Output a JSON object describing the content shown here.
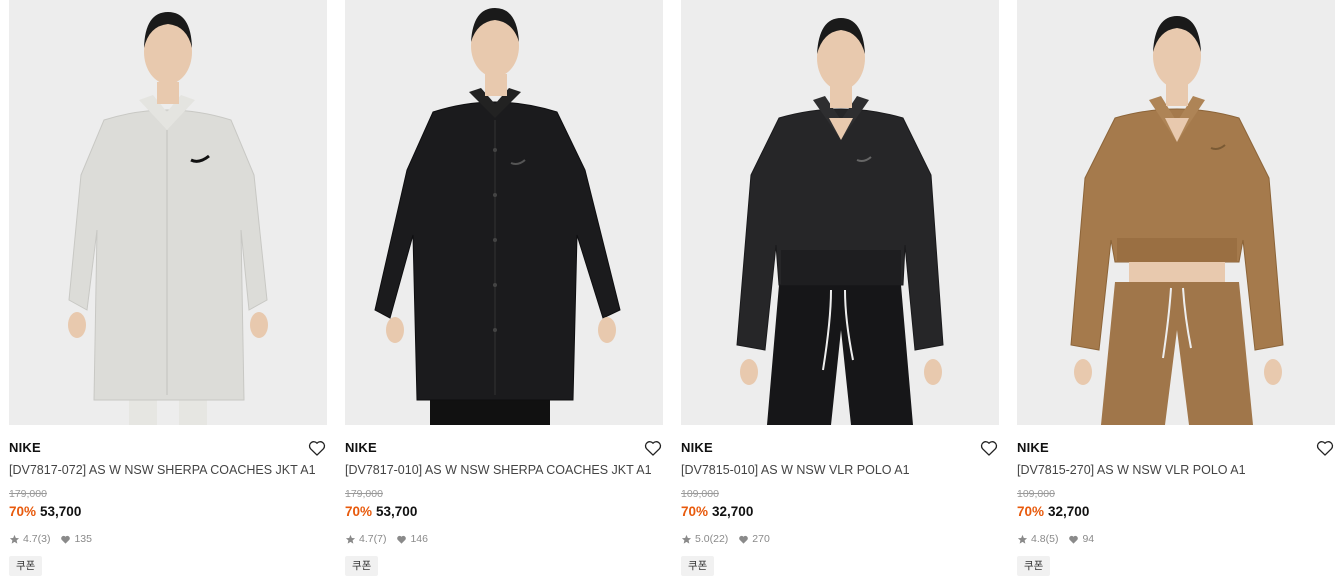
{
  "products": [
    {
      "brand": "NIKE",
      "title": "[DV7817-072] AS W NSW SHERPA COACHES JKT A1",
      "original_price": "179,000",
      "discount": "70%",
      "price": "53,700",
      "rating": "4.7",
      "reviews": "(3)",
      "likes": "135",
      "coupon": "쿠폰",
      "garment_color": "#dcdcd8"
    },
    {
      "brand": "NIKE",
      "title": "[DV7817-010] AS W NSW SHERPA COACHES JKT A1",
      "original_price": "179,000",
      "discount": "70%",
      "price": "53,700",
      "rating": "4.7",
      "reviews": "(7)",
      "likes": "146",
      "coupon": "쿠폰",
      "garment_color": "#1b1b1d"
    },
    {
      "brand": "NIKE",
      "title": "[DV7815-010] AS W NSW VLR POLO A1",
      "original_price": "109,000",
      "discount": "70%",
      "price": "32,700",
      "rating": "5.0",
      "reviews": "(22)",
      "likes": "270",
      "coupon": "쿠폰",
      "garment_color": "#262628"
    },
    {
      "brand": "NIKE",
      "title": "[DV7815-270] AS W NSW VLR POLO A1",
      "original_price": "109,000",
      "discount": "70%",
      "price": "32,700",
      "rating": "4.8",
      "reviews": "(5)",
      "likes": "94",
      "coupon": "쿠폰",
      "garment_color": "#a57a4c"
    }
  ],
  "colors": {
    "discount": "#e85a0c",
    "photo_bg": "#ededed",
    "skin": "#e8c9ae",
    "hair": "#1a1a1a"
  },
  "icons": {
    "wishlist": "heart-outline-icon",
    "rating": "star-icon",
    "likes": "heart-filled-icon"
  }
}
